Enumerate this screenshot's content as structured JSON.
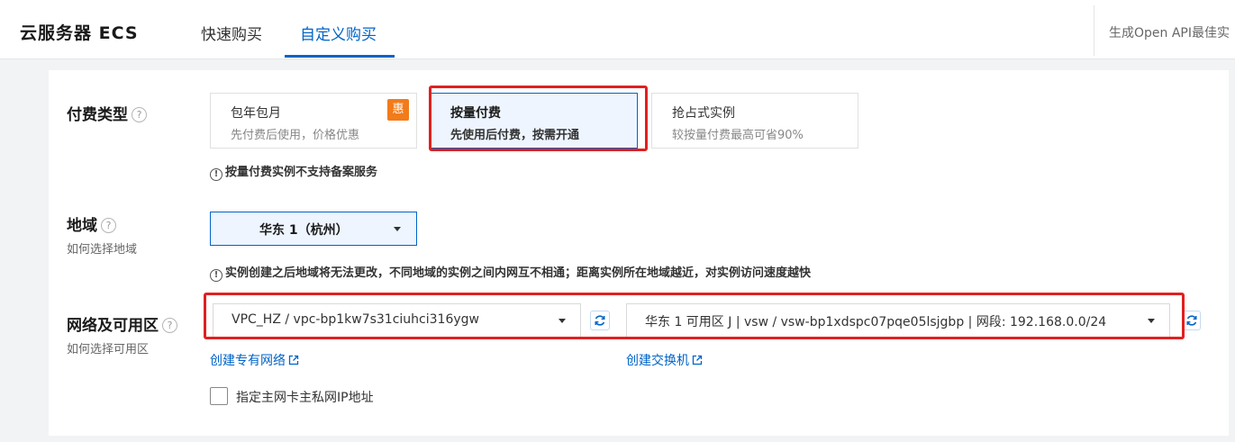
{
  "header": {
    "title": "云服务器 ECS",
    "tabs": [
      {
        "label": "快速购买",
        "active": false
      },
      {
        "label": "自定义购买",
        "active": true
      }
    ],
    "api_link": "生成Open API最佳实"
  },
  "billing": {
    "label": "付费类型",
    "help_icon": "question-circle-icon",
    "options": [
      {
        "title": "包年包月",
        "desc": "先付费后使用，价格优惠",
        "badge": "惠",
        "selected": false
      },
      {
        "title": "按量付费",
        "desc": "先使用后付费，按需开通",
        "selected": true
      },
      {
        "title": "抢占式实例",
        "desc": "较按量付费最高可省90%",
        "selected": false
      }
    ],
    "note": "按量付费实例不支持备案服务"
  },
  "region": {
    "label": "地域",
    "help_link": "如何选择地域",
    "selected": "华东 1（杭州）",
    "note": "实例创建之后地域将无法更改，不同地域的实例之间内网互不相通；距离实例所在地域越近，对实例访问速度越快"
  },
  "network": {
    "label": "网络及可用区",
    "help_link": "如何选择可用区",
    "vpc_value": "VPC_HZ / vpc-bp1kw7s31ciuhci316ygw",
    "vswitch_value": "华东 1 可用区 J | vsw / vsw-bp1xdspc07pqe05lsjgbp | 网段: 192.168.0.0/24",
    "create_vpc_link": "创建专有网络",
    "create_vswitch_link": "创建交换机",
    "private_ip_checkbox_label": "指定主网卡主私网IP地址",
    "private_ip_checked": false
  },
  "colors": {
    "accent": "#0064c8",
    "highlight": "#e02020",
    "promo": "#f27b1a"
  }
}
